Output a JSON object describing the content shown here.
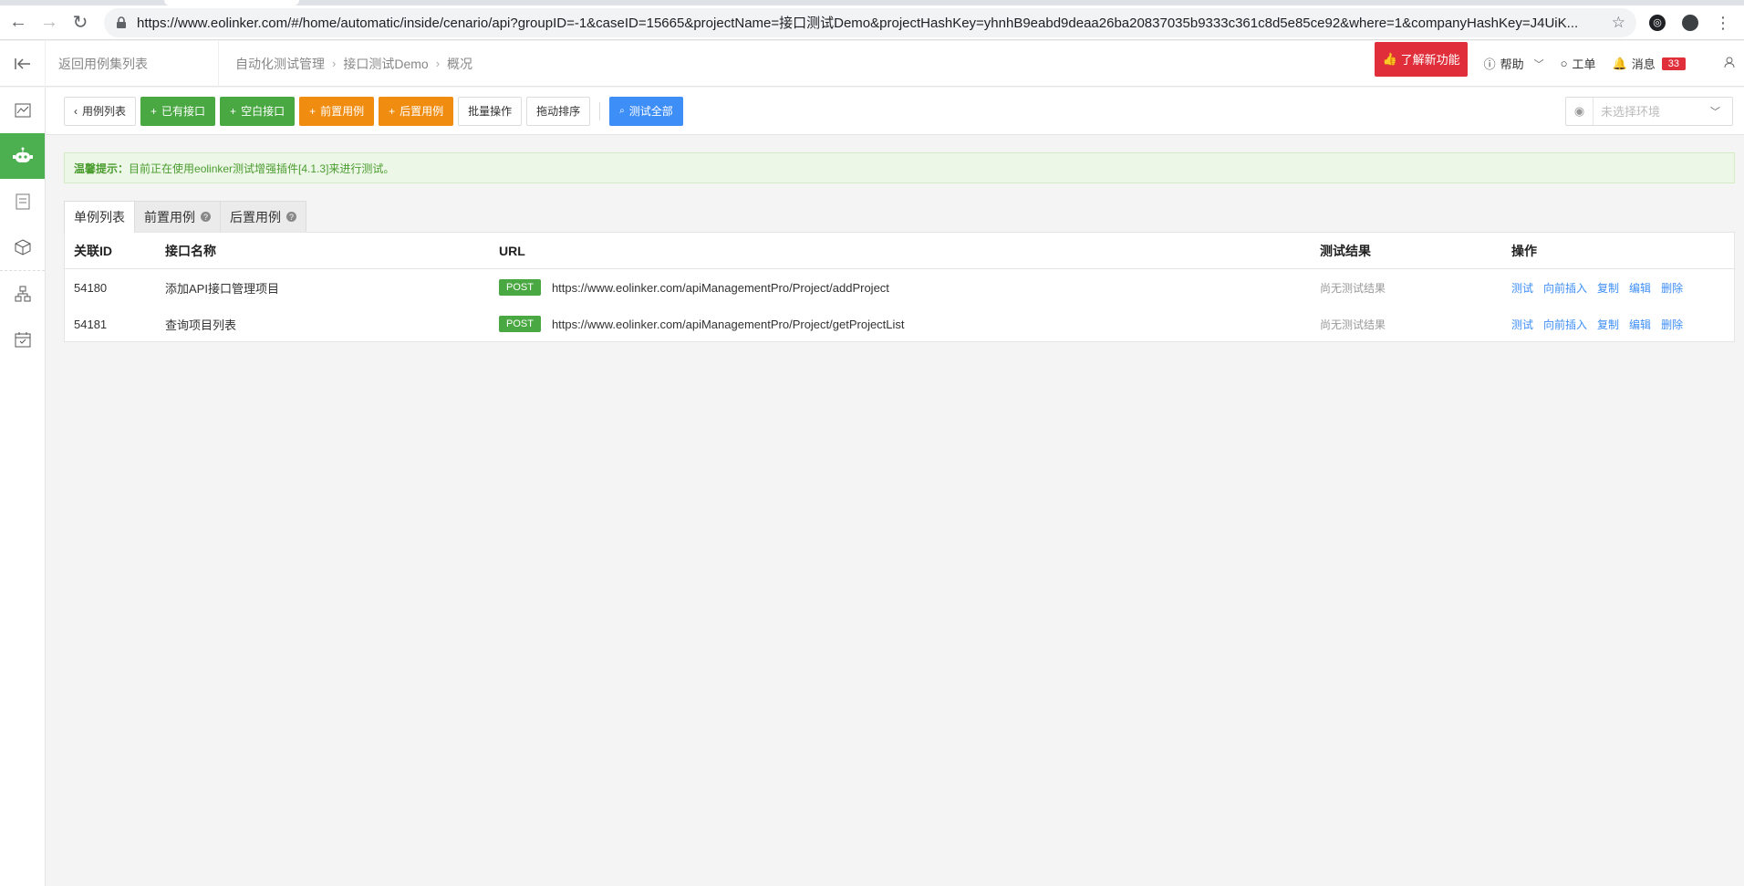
{
  "browser": {
    "url": "https://www.eolinker.com/#/home/automatic/inside/cenario/api?groupID=-1&caseID=15665&projectName=接口测试Demo&projectHashKey=yhnhB9eabd9deaa26ba20837035b9333c361c8d5e85ce92&where=1&companyHashKey=J4UiK..."
  },
  "header": {
    "back_label": "返回用例集列表",
    "breadcrumb": [
      "自动化测试管理",
      "接口测试Demo",
      "概况"
    ],
    "new_feature": "了解新功能",
    "help": "帮助",
    "ticket": "工单",
    "messages": "消息",
    "message_count": "33"
  },
  "toolbar": {
    "case_list": "用例列表",
    "existing_api": "已有接口",
    "blank_api": "空白接口",
    "pre_case": "前置用例",
    "post_case": "后置用例",
    "batch_ops": "批量操作",
    "drag_sort": "拖动排序",
    "test_all": "测试全部",
    "env_placeholder": "未选择环境"
  },
  "notice": {
    "label": "温馨提示：",
    "text": "目前正在使用eolinker测试增强插件[4.1.3]来进行测试。"
  },
  "tabs": [
    "单例列表",
    "前置用例",
    "后置用例"
  ],
  "table": {
    "headers": {
      "id": "关联ID",
      "name": "接口名称",
      "url": "URL",
      "result": "测试结果",
      "ops": "操作"
    },
    "rows": [
      {
        "id": "54180",
        "name": "添加API接口管理项目",
        "method": "POST",
        "url": "https://www.eolinker.com/apiManagementPro/Project/addProject",
        "result": "尚无测试结果"
      },
      {
        "id": "54181",
        "name": "查询项目列表",
        "method": "POST",
        "url": "https://www.eolinker.com/apiManagementPro/Project/getProjectList",
        "result": "尚无测试结果"
      }
    ],
    "ops": [
      "测试",
      "向前插入",
      "复制",
      "编辑",
      "删除"
    ]
  },
  "colors": {
    "green": "#4aa843",
    "orange": "#f08c10",
    "blue": "#3e8ef7",
    "red": "#e02f3b"
  },
  "icons": [
    "back-icon",
    "forward-icon",
    "reload-icon",
    "lock-icon",
    "star-icon",
    "collapse-icon",
    "chart-icon",
    "robot-icon",
    "document-icon",
    "cube-icon",
    "sitemap-icon",
    "calendar-icon",
    "thumb-up-icon",
    "info-icon",
    "chat-icon",
    "bell-icon",
    "user-icon",
    "eye-icon"
  ]
}
